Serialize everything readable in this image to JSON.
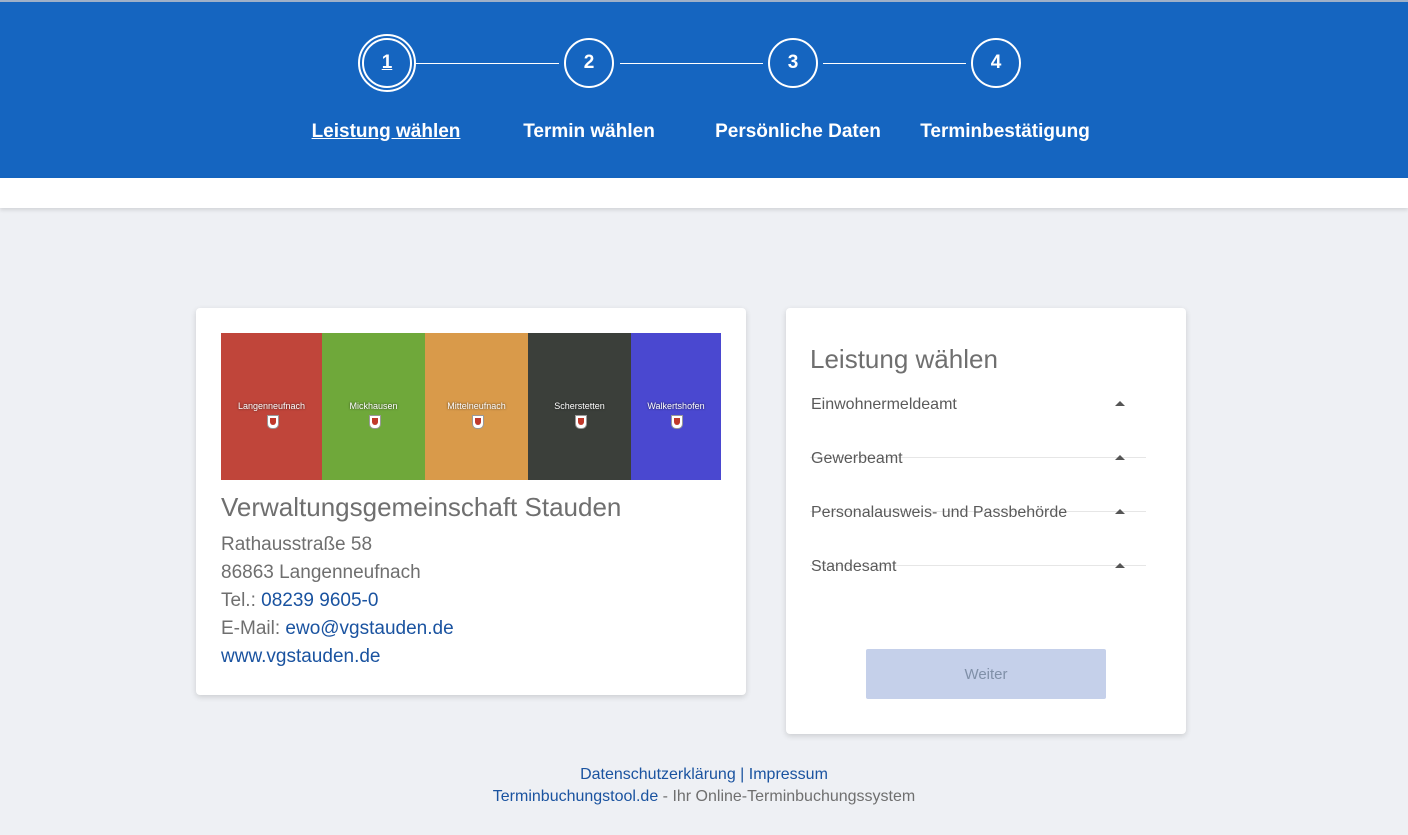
{
  "stepper": {
    "steps": [
      {
        "number": "1",
        "label": "Leistung wählen"
      },
      {
        "number": "2",
        "label": "Termin wählen"
      },
      {
        "number": "3",
        "label": "Persönliche Daten"
      },
      {
        "number": "4",
        "label": "Terminbestätigung"
      }
    ],
    "active_step": "1"
  },
  "office": {
    "banner_towns": [
      "Langenneufnach",
      "Mickhausen",
      "Mittelneufnach",
      "Scherstetten",
      "Walkertshofen"
    ],
    "banner_colors": [
      "#c0453a",
      "#6fa83a",
      "#d99a4a",
      "#3b3f3a",
      "#4a48d0"
    ],
    "name": "Verwaltungsgemeinschaft Stauden",
    "street": "Rathausstraße 58",
    "city": "86863 Langenneufnach",
    "phone_label": "Tel.:",
    "phone": "08239 9605-0",
    "email_label": "E-Mail:",
    "email": "ewo@vgstauden.de",
    "website": "www.vgstauden.de"
  },
  "services": {
    "title": "Leistung wählen",
    "items": [
      {
        "label": "Einwohnermeldeamt"
      },
      {
        "label": "Gewerbeamt"
      },
      {
        "label": "Personalausweis- und Passbehörde"
      },
      {
        "label": "Standesamt"
      }
    ],
    "next_button": "Weiter"
  },
  "footer": {
    "privacy": "Datenschutzerklärung",
    "separator": "|",
    "imprint": "Impressum",
    "tool_link": "Terminbuchungstool.de",
    "tool_suffix": " - Ihr Online-Terminbuchungssystem"
  },
  "colors": {
    "header": "#1565c0",
    "background": "#eef0f4",
    "link": "#1a53a0",
    "button_disabled": "#c5d0ea"
  }
}
